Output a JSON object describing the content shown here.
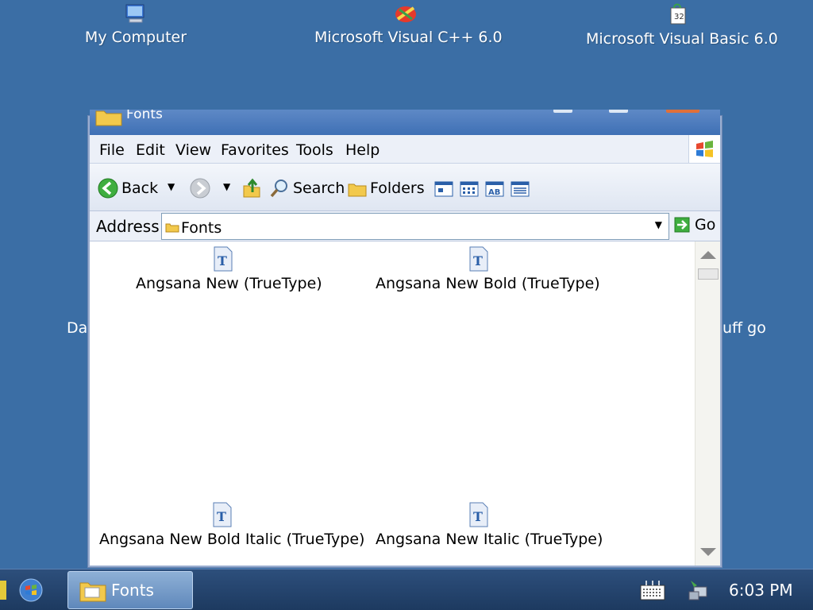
{
  "desktop": {
    "icons": [
      {
        "label": "My Computer"
      },
      {
        "label": "Microsoft Visual C++ 6.0"
      },
      {
        "label": "Microsoft Visual Basic 6.0"
      }
    ],
    "partial_left": "Dat",
    "partial_right": "uff go"
  },
  "window": {
    "title": "Fonts",
    "menu": [
      "File",
      "Edit",
      "View",
      "Favorites",
      "Tools",
      "Help"
    ],
    "toolbar": {
      "back_label": "Back",
      "search_label": "Search",
      "folders_label": "Folders"
    },
    "address": {
      "label": "Address",
      "value": "Fonts",
      "go_label": "Go"
    },
    "items": [
      {
        "label": "Angsana New (TrueType)"
      },
      {
        "label": "Angsana New Bold (TrueType)"
      },
      {
        "label": "Angsana New Bold Italic (TrueType)"
      },
      {
        "label": "Angsana New Italic (TrueType)"
      }
    ]
  },
  "taskbar": {
    "task_label": "Fonts",
    "clock": "6:03 PM"
  },
  "colors": {
    "desktop": "#3b6ea5",
    "taskbar": "#1d3a60",
    "font_icon": "#2a5fa8"
  }
}
